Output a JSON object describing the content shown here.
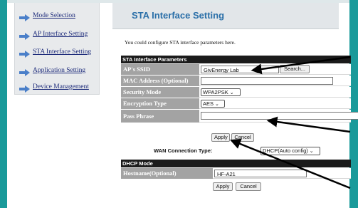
{
  "sidebar": {
    "items": [
      {
        "label": "Mode Selection"
      },
      {
        "label": "AP Interface Setting"
      },
      {
        "label": "STA Interface Setting"
      },
      {
        "label": "Application Setting"
      },
      {
        "label": "Device Management"
      }
    ]
  },
  "header": {
    "title": "STA Interface Setting"
  },
  "intro": "You could configure STA interface parameters here.",
  "sta_params": {
    "section_title": "STA Interface Parameters",
    "ssid_label": "AP's SSID",
    "ssid_value": "GivEnergy Lab",
    "search_label": "Search...",
    "mac_label": "MAC Address (Optional)",
    "mac_value": "",
    "security_label": "Security Mode",
    "security_value": "WPA2PSK",
    "encryption_label": "Encryption Type",
    "encryption_value": "AES",
    "pass_label": "Pass Phrase",
    "pass_value": ""
  },
  "actions1": {
    "apply": "Apply",
    "cancel": "Cancel"
  },
  "wan": {
    "label": "WAN Connection Type:",
    "value": "DHCP(Auto config)"
  },
  "dhcp": {
    "section_title": "DHCP Mode",
    "hostname_label": "Hostname(Optional)",
    "hostname_value": "HF-A21"
  },
  "actions2": {
    "apply": "Apply",
    "cancel": "Cancel"
  },
  "colors": {
    "accent": "#1a9a9a",
    "title": "#2a6fa8",
    "label_bg": "#a3a3a3",
    "section_bg": "#1b1b1b"
  }
}
